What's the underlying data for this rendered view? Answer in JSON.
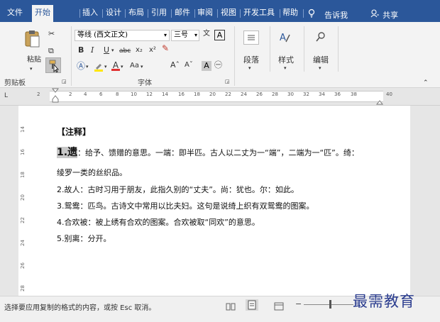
{
  "tabs": [
    {
      "label": "文件",
      "active": false
    },
    {
      "label": "开始",
      "active": true
    },
    {
      "label": "插入",
      "active": false
    },
    {
      "label": "设计",
      "active": false
    },
    {
      "label": "布局",
      "active": false
    },
    {
      "label": "引用",
      "active": false
    },
    {
      "label": "邮件",
      "active": false
    },
    {
      "label": "审阅",
      "active": false
    },
    {
      "label": "视图",
      "active": false
    },
    {
      "label": "开发工具",
      "active": false
    },
    {
      "label": "帮助",
      "active": false
    }
  ],
  "tell_me": "告诉我",
  "share": "共享",
  "clipboard": {
    "paste_label": "粘贴",
    "group_label": "剪贴板"
  },
  "font": {
    "font_name": "等线 (西文正文)",
    "font_size": "三号",
    "group_label": "字体",
    "wen": "文",
    "aa": "Aa"
  },
  "paragraph": {
    "label": "段落"
  },
  "styles": {
    "label": "样式"
  },
  "editing": {
    "label": "编辑"
  },
  "ruler_numbers": [
    "2",
    "2",
    "4",
    "6",
    "8",
    "10",
    "12",
    "14",
    "16",
    "18",
    "20",
    "22",
    "24",
    "26",
    "28",
    "30",
    "32",
    "34",
    "36",
    "38",
    "40"
  ],
  "vruler_numbers": [
    "14",
    "16",
    "18",
    "20",
    "22",
    "24",
    "26",
    "28"
  ],
  "document": {
    "heading": "【注释】",
    "lines": [
      {
        "number": "1.",
        "term": "遗",
        "text": "：给予、馈赠的意思。一端：即半匹。古人以二丈为一“端”，二端为一“匹”。绮："
      },
      {
        "text": "绫罗一类的丝织品。"
      },
      {
        "text": "2.故人：古时习用于朋友，此指久别的“丈夫”。尚：犹也。尔：如此。"
      },
      {
        "text": "3.鸳鸯：匹鸟。古诗文中常用以比夫妇。这句是说绮上织有双鸳鸯的图案。"
      },
      {
        "text": "4.合欢被：被上绣有合欢的图案。合欢被取“同欢”的意思。"
      },
      {
        "text": "5.别离：分开。"
      }
    ]
  },
  "status": {
    "message": "选择要应用复制的格式的内容，或按 Esc 取消。"
  },
  "watermark": "最需教育",
  "colors": {
    "accent": "#2b579a",
    "ribbon": "#f3f3f3",
    "highlight_term": "#c8c8c8",
    "watermark": "#2b3d8f"
  }
}
